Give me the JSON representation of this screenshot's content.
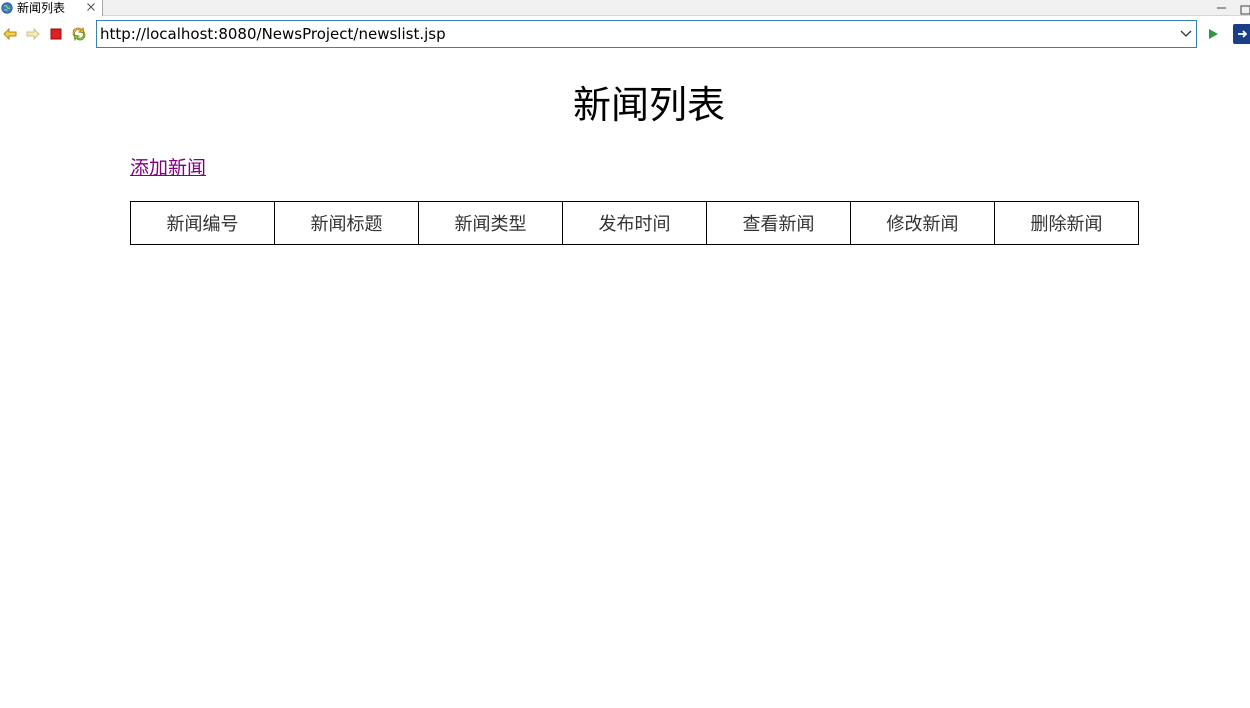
{
  "browser": {
    "tab_title": "新闻列表",
    "address": "http://localhost:8080/NewsProject/newslist.jsp"
  },
  "page": {
    "title": "新闻列表",
    "add_link": "添加新闻",
    "table": {
      "headers": [
        "新闻编号",
        "新闻标题",
        "新闻类型",
        "发布时间",
        "查看新闻",
        "修改新闻",
        "删除新闻"
      ],
      "rows": []
    }
  },
  "colors": {
    "visited_link": "#800080",
    "address_border": "#3c7fb1",
    "stop_red": "#e02020",
    "go_green": "#2e9a3c"
  }
}
